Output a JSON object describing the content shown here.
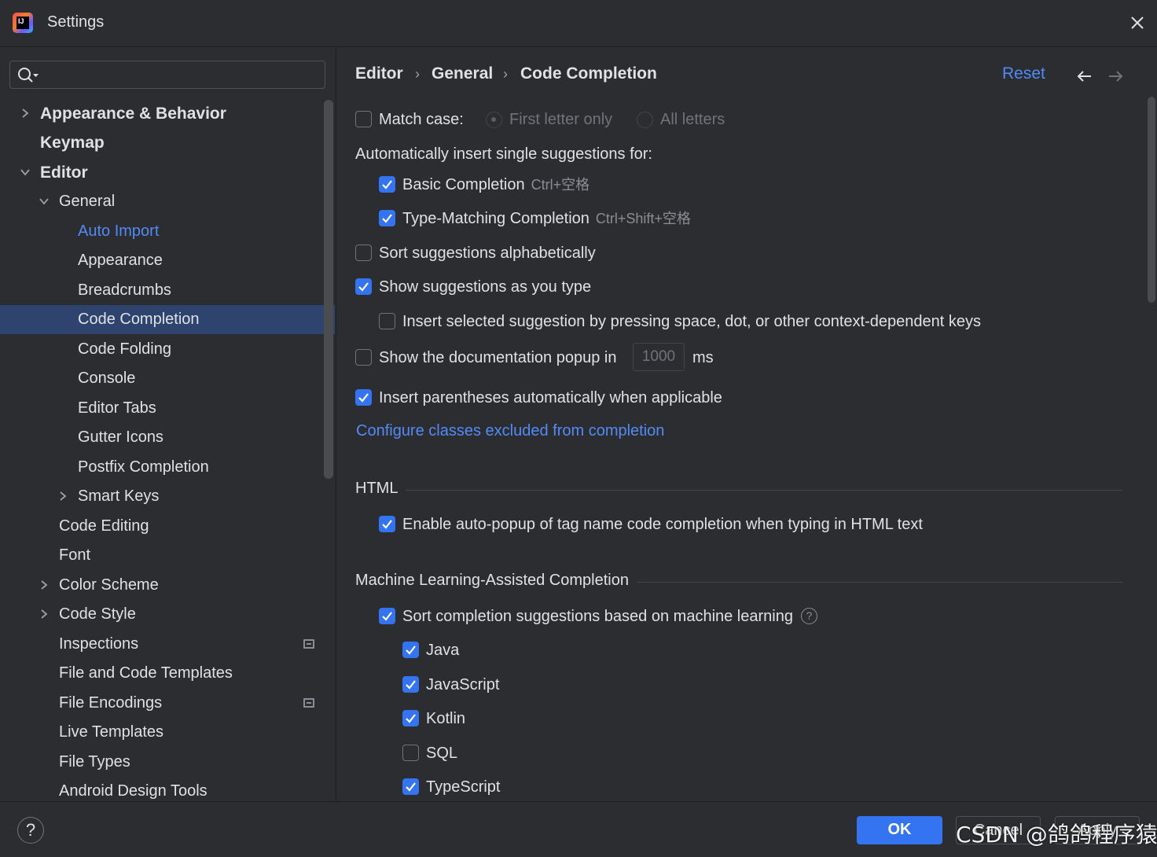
{
  "window": {
    "title": "Settings"
  },
  "search": {
    "value": ""
  },
  "tree": [
    {
      "label": "Appearance & Behavior"
    },
    {
      "label": "Keymap"
    },
    {
      "label": "Editor"
    },
    {
      "label": "General"
    },
    {
      "label": "Auto Import"
    },
    {
      "label": "Appearance"
    },
    {
      "label": "Breadcrumbs"
    },
    {
      "label": "Code Completion"
    },
    {
      "label": "Code Folding"
    },
    {
      "label": "Console"
    },
    {
      "label": "Editor Tabs"
    },
    {
      "label": "Gutter Icons"
    },
    {
      "label": "Postfix Completion"
    },
    {
      "label": "Smart Keys"
    },
    {
      "label": "Code Editing"
    },
    {
      "label": "Font"
    },
    {
      "label": "Color Scheme"
    },
    {
      "label": "Code Style"
    },
    {
      "label": "Inspections"
    },
    {
      "label": "File and Code Templates"
    },
    {
      "label": "File Encodings"
    },
    {
      "label": "Live Templates"
    },
    {
      "label": "File Types"
    },
    {
      "label": "Android Design Tools"
    }
  ],
  "breadcrumb": {
    "items": [
      "Editor",
      "General",
      "Code Completion"
    ],
    "separator": "›"
  },
  "header": {
    "reset_label": "Reset"
  },
  "completion": {
    "match_case": {
      "label": "Match case:",
      "checked": false
    },
    "match_first_letter": {
      "label": "First letter only",
      "selected": true
    },
    "match_all_letters": {
      "label": "All letters",
      "selected": false
    },
    "auto_insert_heading": "Automatically insert single suggestions for:",
    "basic": {
      "label": "Basic Completion",
      "shortcut": "Ctrl+空格",
      "checked": true
    },
    "type_matching": {
      "label": "Type-Matching Completion",
      "shortcut": "Ctrl+Shift+空格",
      "checked": true
    },
    "sort_alpha": {
      "label": "Sort suggestions alphabetically",
      "checked": false
    },
    "show_as_type": {
      "label": "Show suggestions as you type",
      "checked": true
    },
    "insert_selected": {
      "label": "Insert selected suggestion by pressing space, dot, or other context-dependent keys",
      "checked": false
    },
    "doc_popup": {
      "label": "Show the documentation popup in",
      "value": "1000",
      "unit": "ms",
      "checked": false
    },
    "insert_parens": {
      "label": "Insert parentheses automatically when applicable",
      "checked": true
    },
    "configure_link": "Configure classes excluded from completion"
  },
  "html_section": {
    "title": "HTML",
    "auto_popup": {
      "label": "Enable auto-popup of tag name code completion when typing in HTML text",
      "checked": true
    }
  },
  "ml_section": {
    "title": "Machine Learning-Assisted Completion",
    "sort_ml": {
      "label": "Sort completion suggestions based on machine learning",
      "help": "?",
      "checked": true
    },
    "languages": [
      {
        "label": "Java",
        "checked": true
      },
      {
        "label": "JavaScript",
        "checked": true
      },
      {
        "label": "Kotlin",
        "checked": true
      },
      {
        "label": "SQL",
        "checked": false
      },
      {
        "label": "TypeScript",
        "checked": true
      }
    ]
  },
  "footer": {
    "help": "?",
    "ok": "OK",
    "cancel": "Cancel",
    "apply": "Apply"
  },
  "watermark": "CSDN @鸽鸽程序猿",
  "colors": {
    "accent": "#3574f0",
    "link": "#548af7",
    "selection": "#2e436e",
    "background": "#2b2d30"
  }
}
